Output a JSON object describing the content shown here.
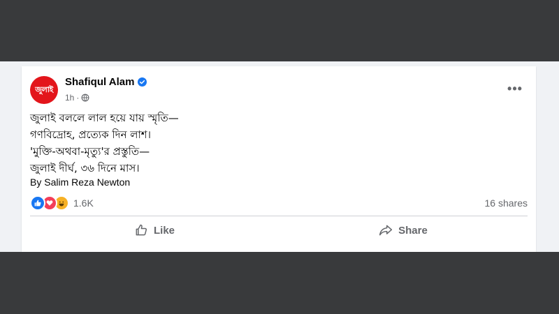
{
  "post": {
    "author": "Shafiqul Alam",
    "avatar_text": "জুলাই",
    "time": "1h",
    "separator": "·",
    "lines": [
      "জুলাই বললে লাল হয়ে যায় স্মৃতি—",
      "গণবিদ্রোহ, প্রত্যেক দিন লাশ।",
      "'মুক্তি-অথবা-মৃত্যু'র প্রস্তুতি—",
      "জুলাই দীর্ঘ, ৩৬ দিনে মাস।"
    ],
    "byline": "By Salim Reza Newton",
    "reaction_count": "1.6K",
    "shares": "16 shares"
  },
  "actions": {
    "like": "Like",
    "share": "Share"
  },
  "colors": {
    "brand": "#1877f2",
    "avatar_bg": "#e3151b",
    "band": "#393a3c"
  }
}
